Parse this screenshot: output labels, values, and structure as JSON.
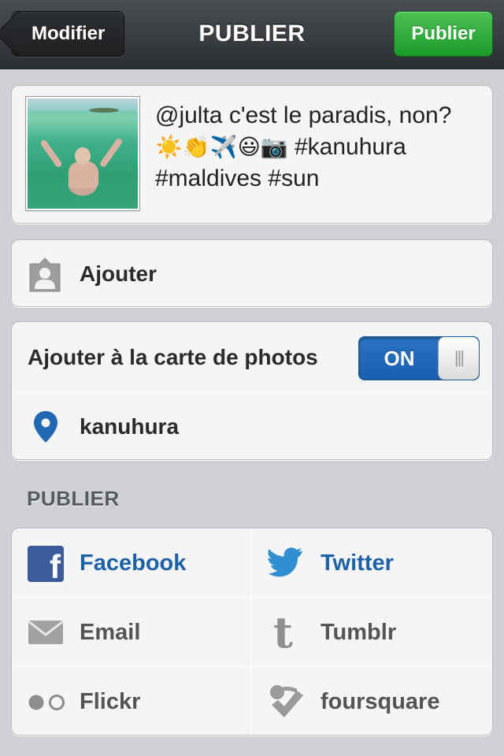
{
  "navbar": {
    "title": "PUBLIER",
    "back_label": "Modifier",
    "publish_label": "Publier"
  },
  "caption": {
    "text_line1": "@julta c'est le paradis, non?",
    "emojis": "☀️👏✈️😃📷",
    "text_tag": " #kanuhura",
    "text_line3": "#maldives #sun"
  },
  "tag_people": {
    "label": "Ajouter",
    "icon": "person-tag-icon"
  },
  "photo_map": {
    "label": "Ajouter à la carte de photos",
    "toggle_state": "ON",
    "location": "kanuhura",
    "location_icon": "location-pin-icon"
  },
  "share": {
    "section_title": "PUBLIER",
    "services": [
      {
        "label": "Facebook",
        "icon": "facebook-icon",
        "active": true
      },
      {
        "label": "Twitter",
        "icon": "twitter-icon",
        "active": true
      },
      {
        "label": "Email",
        "icon": "email-icon",
        "active": false
      },
      {
        "label": "Tumblr",
        "icon": "tumblr-icon",
        "active": false
      },
      {
        "label": "Flickr",
        "icon": "flickr-icon",
        "active": false
      },
      {
        "label": "foursquare",
        "icon": "foursquare-icon",
        "active": false
      }
    ]
  },
  "colors": {
    "active_link": "#1d62a8",
    "publish_green": "#1b9a2a",
    "toggle_blue": "#2c72c2"
  }
}
